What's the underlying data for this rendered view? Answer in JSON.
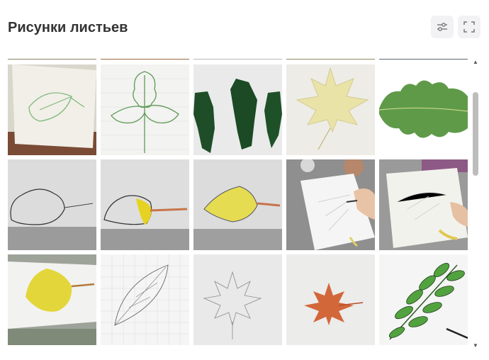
{
  "header": {
    "title": "Рисунки листьев"
  },
  "header_buttons": [
    {
      "icon": "sliders-icon"
    },
    {
      "icon": "fullscreen-icon"
    }
  ],
  "gallery": {
    "items": [
      {
        "subject": "birch leaf outline drawing"
      },
      {
        "subject": "oak leaf outline drawing"
      },
      {
        "subject": "green painted leaf silhouettes"
      },
      {
        "subject": "yellow maple leaf drawing"
      },
      {
        "subject": "green oak leaf photo"
      },
      {
        "subject": "leaf outline sketch"
      },
      {
        "subject": "leaf being colored yellow"
      },
      {
        "subject": "yellow colored leaf"
      },
      {
        "subject": "hand drawing leaf veins"
      },
      {
        "subject": "hand coloring leaf"
      },
      {
        "subject": "yellow linden leaf drawing"
      },
      {
        "subject": "pencil leaf sketch on grid paper"
      },
      {
        "subject": "maple leaf pencil sketch"
      },
      {
        "subject": "orange maple leaf drawing"
      },
      {
        "subject": "green rowan leaf drawing"
      }
    ]
  },
  "colors": {
    "title": "#333333",
    "button_bg": "#f2f2f4",
    "scroll_thumb": "#bdbdbd"
  }
}
